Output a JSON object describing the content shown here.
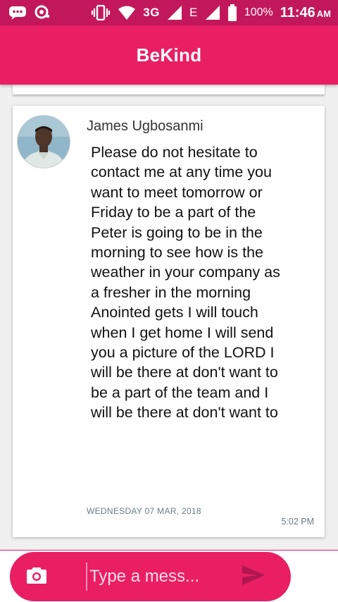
{
  "status_bar": {
    "network": "3G",
    "network_secondary": "E",
    "battery": "100%",
    "time": "11:46",
    "ampm": "AM",
    "background": "#c2185b",
    "icons": [
      "chat-icon",
      "location-icon",
      "vibrate-icon",
      "wifi-icon",
      "signal-icon",
      "signal-icon",
      "battery-icon"
    ]
  },
  "app_bar": {
    "title": "BeKind",
    "color": "#e91e63"
  },
  "message": {
    "sender": "James Ugbosanmi",
    "body": "Please do not hesitate to contact me at any time you want to meet tomorrow or Friday to be a part of the Peter is going to be in the morning to see how is the weather in your company as a fresher in the morning Anointed gets I will touch when I get home I will send you a picture of the LORD I will be there at don't want to be a part of the team and I will be there at don't want to",
    "date": "WEDNESDAY 07 MAR, 2018",
    "time": "5:02 PM"
  },
  "composer": {
    "placeholder": "Type a mess...",
    "camera_icon": "camera-icon",
    "send_icon": "send-icon"
  }
}
